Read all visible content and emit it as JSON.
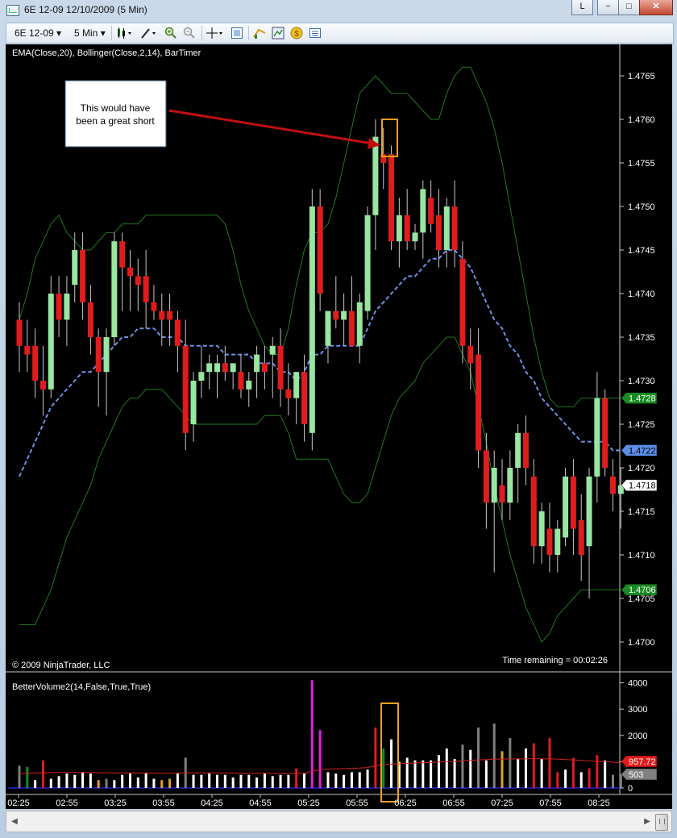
{
  "window": {
    "title": "6E 12-09  12/10/2009 (5 Min)",
    "buttons": {
      "layout": "L",
      "minimize": "−",
      "maximize": "□",
      "close": "✕"
    }
  },
  "toolbar": {
    "instrument": "6E 12-09",
    "interval": "5 Min",
    "icons": [
      "candlestick-style-icon",
      "drawing-tools-icon",
      "zoom-in-icon",
      "zoom-out-icon",
      "crosshair-icon",
      "data-box-icon",
      "bar-chart-icon",
      "chart-properties-icon",
      "order-entry-icon",
      "indicators-icon"
    ]
  },
  "price_panel": {
    "indicator_label": "EMA(Close,20), Bollinger(Close,2,14), BarTimer",
    "copyright": "© 2009 NinjaTrader, LLC",
    "timer_text": "Time remaining = 00:02:26",
    "annotation_text_1": "This would have",
    "annotation_text_2": "been a great short",
    "y_ticks": [
      "1.4765",
      "1.4760",
      "1.4755",
      "1.4750",
      "1.4745",
      "1.4740",
      "1.4735",
      "1.4730",
      "1.4725",
      "1.4720",
      "1.4715",
      "1.4710",
      "1.4705",
      "1.4700"
    ],
    "markers": [
      {
        "label": "1.4728",
        "color": "#1a8a22",
        "text_color": "#ffffff"
      },
      {
        "label": "1.4722",
        "color": "#5b8ee6",
        "text_color": "#000000"
      },
      {
        "label": "1.4718",
        "color": "#ffffff",
        "text_color": "#000000"
      },
      {
        "label": "1.4706",
        "color": "#1a8a22",
        "text_color": "#ffffff"
      }
    ]
  },
  "volume_panel": {
    "indicator_label": "BetterVolume2(14,False,True,True)",
    "y_ticks": [
      "4000",
      "3000",
      "2000",
      "1000",
      "0"
    ],
    "markers": [
      {
        "label": "957.72",
        "color": "#e31b1b",
        "text_color": "#ffffff"
      },
      {
        "label": "503",
        "color": "#808080",
        "text_color": "#ffffff"
      }
    ]
  },
  "x_ticks": [
    "02:25",
    "02:55",
    "03:25",
    "03:55",
    "04:25",
    "04:55",
    "05:25",
    "05:55",
    "06:25",
    "06:55",
    "07:25",
    "07:55",
    "08:25"
  ],
  "colors": {
    "up_candle": "#98e6a0",
    "down_candle": "#e01c1c",
    "wick": "#c8c8c8",
    "ema": "#6f8fe8",
    "bollinger": "#1f7a1f",
    "arrow": "#c01010",
    "highlight_box": "#f0a020",
    "volume_avg": "#d42020"
  },
  "chart_data": [
    {
      "type": "candlestick",
      "title": "6E 12-09 12/10/2009 (5 Min)",
      "ylim": [
        1.4698,
        1.4768
      ],
      "x_tick_labels": [
        "02:25",
        "02:55",
        "03:25",
        "03:55",
        "04:25",
        "04:55",
        "05:25",
        "05:55",
        "06:25",
        "06:55",
        "07:25",
        "07:55",
        "08:25"
      ],
      "candles": [
        {
          "o": 1.4737,
          "h": 1.4739,
          "l": 1.4731,
          "c": 1.4734
        },
        {
          "o": 1.4734,
          "h": 1.4737,
          "l": 1.4731,
          "c": 1.4733
        },
        {
          "o": 1.4734,
          "h": 1.4736,
          "l": 1.4728,
          "c": 1.473
        },
        {
          "o": 1.473,
          "h": 1.4734,
          "l": 1.4726,
          "c": 1.4729
        },
        {
          "o": 1.4729,
          "h": 1.4742,
          "l": 1.4728,
          "c": 1.474
        },
        {
          "o": 1.474,
          "h": 1.4742,
          "l": 1.4735,
          "c": 1.4737
        },
        {
          "o": 1.4737,
          "h": 1.4742,
          "l": 1.4734,
          "c": 1.474
        },
        {
          "o": 1.4741,
          "h": 1.4747,
          "l": 1.4739,
          "c": 1.4745
        },
        {
          "o": 1.4745,
          "h": 1.4747,
          "l": 1.4737,
          "c": 1.4739
        },
        {
          "o": 1.4739,
          "h": 1.4741,
          "l": 1.4733,
          "c": 1.4735
        },
        {
          "o": 1.4735,
          "h": 1.4736,
          "l": 1.4727,
          "c": 1.4731
        },
        {
          "o": 1.4731,
          "h": 1.4736,
          "l": 1.4726,
          "c": 1.4735
        },
        {
          "o": 1.4735,
          "h": 1.4747,
          "l": 1.4734,
          "c": 1.4746
        },
        {
          "o": 1.4746,
          "h": 1.4747,
          "l": 1.4738,
          "c": 1.4743
        },
        {
          "o": 1.4743,
          "h": 1.4745,
          "l": 1.4738,
          "c": 1.4742
        },
        {
          "o": 1.4742,
          "h": 1.4744,
          "l": 1.4738,
          "c": 1.4741
        },
        {
          "o": 1.4742,
          "h": 1.4745,
          "l": 1.4736,
          "c": 1.4739
        },
        {
          "o": 1.4739,
          "h": 1.4741,
          "l": 1.4737,
          "c": 1.4738
        },
        {
          "o": 1.4738,
          "h": 1.474,
          "l": 1.4734,
          "c": 1.4737
        },
        {
          "o": 1.4738,
          "h": 1.474,
          "l": 1.4734,
          "c": 1.4737
        },
        {
          "o": 1.4737,
          "h": 1.4738,
          "l": 1.4731,
          "c": 1.4734
        },
        {
          "o": 1.4734,
          "h": 1.4737,
          "l": 1.4722,
          "c": 1.4724
        },
        {
          "o": 1.4725,
          "h": 1.4731,
          "l": 1.4723,
          "c": 1.473
        },
        {
          "o": 1.473,
          "h": 1.4734,
          "l": 1.4728,
          "c": 1.4731
        },
        {
          "o": 1.4731,
          "h": 1.4733,
          "l": 1.4729,
          "c": 1.4732
        },
        {
          "o": 1.4731,
          "h": 1.4733,
          "l": 1.4728,
          "c": 1.4732
        },
        {
          "o": 1.4732,
          "h": 1.4734,
          "l": 1.473,
          "c": 1.4731
        },
        {
          "o": 1.4731,
          "h": 1.4732,
          "l": 1.4729,
          "c": 1.4732
        },
        {
          "o": 1.4731,
          "h": 1.4733,
          "l": 1.4728,
          "c": 1.4729
        },
        {
          "o": 1.4729,
          "h": 1.4731,
          "l": 1.4727,
          "c": 1.473
        },
        {
          "o": 1.4731,
          "h": 1.4734,
          "l": 1.4728,
          "c": 1.4733
        },
        {
          "o": 1.4732,
          "h": 1.4734,
          "l": 1.4729,
          "c": 1.4731
        },
        {
          "o": 1.4733,
          "h": 1.4735,
          "l": 1.4728,
          "c": 1.4734
        },
        {
          "o": 1.4734,
          "h": 1.4736,
          "l": 1.4727,
          "c": 1.4729
        },
        {
          "o": 1.4729,
          "h": 1.4732,
          "l": 1.4726,
          "c": 1.4728
        },
        {
          "o": 1.4728,
          "h": 1.4731,
          "l": 1.4725,
          "c": 1.4731
        },
        {
          "o": 1.4731,
          "h": 1.4733,
          "l": 1.4723,
          "c": 1.4725
        },
        {
          "o": 1.4724,
          "h": 1.4752,
          "l": 1.4722,
          "c": 1.475
        },
        {
          "o": 1.475,
          "h": 1.4752,
          "l": 1.4738,
          "c": 1.474
        },
        {
          "o": 1.4734,
          "h": 1.4738,
          "l": 1.4732,
          "c": 1.4738
        },
        {
          "o": 1.4738,
          "h": 1.4742,
          "l": 1.4736,
          "c": 1.4737
        },
        {
          "o": 1.4737,
          "h": 1.474,
          "l": 1.4734,
          "c": 1.4738
        },
        {
          "o": 1.4738,
          "h": 1.4742,
          "l": 1.4735,
          "c": 1.4734
        },
        {
          "o": 1.4734,
          "h": 1.474,
          "l": 1.4732,
          "c": 1.4739
        },
        {
          "o": 1.4738,
          "h": 1.475,
          "l": 1.4737,
          "c": 1.4749
        },
        {
          "o": 1.4749,
          "h": 1.476,
          "l": 1.4745,
          "c": 1.4758
        },
        {
          "o": 1.4756,
          "h": 1.4759,
          "l": 1.4752,
          "c": 1.4755
        },
        {
          "o": 1.4756,
          "h": 1.4757,
          "l": 1.4745,
          "c": 1.4746
        },
        {
          "o": 1.4746,
          "h": 1.4751,
          "l": 1.4743,
          "c": 1.4749
        },
        {
          "o": 1.4749,
          "h": 1.4752,
          "l": 1.4745,
          "c": 1.4746
        },
        {
          "o": 1.4746,
          "h": 1.4748,
          "l": 1.4745,
          "c": 1.4747
        },
        {
          "o": 1.4747,
          "h": 1.4753,
          "l": 1.4744,
          "c": 1.4752
        },
        {
          "o": 1.4751,
          "h": 1.4753,
          "l": 1.4747,
          "c": 1.4748
        },
        {
          "o": 1.4749,
          "h": 1.4752,
          "l": 1.4743,
          "c": 1.4745
        },
        {
          "o": 1.4745,
          "h": 1.4751,
          "l": 1.4743,
          "c": 1.475
        },
        {
          "o": 1.475,
          "h": 1.4753,
          "l": 1.4743,
          "c": 1.4745
        },
        {
          "o": 1.4744,
          "h": 1.4746,
          "l": 1.4732,
          "c": 1.4734
        },
        {
          "o": 1.4734,
          "h": 1.4736,
          "l": 1.4729,
          "c": 1.4732
        },
        {
          "o": 1.4733,
          "h": 1.4736,
          "l": 1.472,
          "c": 1.4722
        },
        {
          "o": 1.4722,
          "h": 1.4724,
          "l": 1.4713,
          "c": 1.4716
        },
        {
          "o": 1.4716,
          "h": 1.4722,
          "l": 1.4708,
          "c": 1.472
        },
        {
          "o": 1.4718,
          "h": 1.4721,
          "l": 1.4714,
          "c": 1.4716
        },
        {
          "o": 1.4716,
          "h": 1.4722,
          "l": 1.4714,
          "c": 1.472
        },
        {
          "o": 1.472,
          "h": 1.4725,
          "l": 1.4716,
          "c": 1.4724
        },
        {
          "o": 1.4724,
          "h": 1.4726,
          "l": 1.4718,
          "c": 1.472
        },
        {
          "o": 1.4719,
          "h": 1.4721,
          "l": 1.4709,
          "c": 1.4711
        },
        {
          "o": 1.4711,
          "h": 1.4716,
          "l": 1.4709,
          "c": 1.4715
        },
        {
          "o": 1.4713,
          "h": 1.4716,
          "l": 1.4708,
          "c": 1.471
        },
        {
          "o": 1.471,
          "h": 1.4714,
          "l": 1.4708,
          "c": 1.4713
        },
        {
          "o": 1.4712,
          "h": 1.472,
          "l": 1.4711,
          "c": 1.4719
        },
        {
          "o": 1.4719,
          "h": 1.4721,
          "l": 1.471,
          "c": 1.4713
        },
        {
          "o": 1.4714,
          "h": 1.4717,
          "l": 1.4707,
          "c": 1.471
        },
        {
          "o": 1.4711,
          "h": 1.472,
          "l": 1.4705,
          "c": 1.4719
        },
        {
          "o": 1.4719,
          "h": 1.4731,
          "l": 1.4716,
          "c": 1.4728
        },
        {
          "o": 1.4728,
          "h": 1.4729,
          "l": 1.4719,
          "c": 1.472
        },
        {
          "o": 1.4719,
          "h": 1.4721,
          "l": 1.4715,
          "c": 1.4717
        },
        {
          "o": 1.4717,
          "h": 1.472,
          "l": 1.4713,
          "c": 1.4718
        }
      ],
      "ema": [
        1.4719,
        1.4721,
        1.4723,
        1.4725,
        1.4727,
        1.4728,
        1.4729,
        1.473,
        1.4731,
        1.4731,
        1.4732,
        1.4733,
        1.4734,
        1.4735,
        1.4735,
        1.4736,
        1.4736,
        1.4736,
        1.4735,
        1.4735,
        1.4735,
        1.4734,
        1.4734,
        1.4734,
        1.4734,
        1.4734,
        1.4733,
        1.4733,
        1.4733,
        1.4733,
        1.4732,
        1.4732,
        1.4732,
        1.4731,
        1.4731,
        1.473,
        1.4731,
        1.4733,
        1.4733,
        1.4734,
        1.4734,
        1.4734,
        1.4734,
        1.4734,
        1.4736,
        1.4738,
        1.4739,
        1.474,
        1.4741,
        1.4742,
        1.4742,
        1.4743,
        1.4744,
        1.4744,
        1.4745,
        1.4745,
        1.4744,
        1.4743,
        1.4741,
        1.4739,
        1.4737,
        1.4736,
        1.4734,
        1.4733,
        1.4731,
        1.473,
        1.4728,
        1.4727,
        1.4726,
        1.4725,
        1.4724,
        1.4723,
        1.4723,
        1.4723,
        1.4723,
        1.4722,
        1.4722
      ],
      "bollinger_upper": [
        1.4737,
        1.474,
        1.4744,
        1.4746,
        1.4748,
        1.4749,
        1.4747,
        1.4746,
        1.4745,
        1.4745,
        1.4746,
        1.4747,
        1.4747,
        1.4748,
        1.4748,
        1.4748,
        1.4749,
        1.4749,
        1.4749,
        1.4749,
        1.4749,
        1.4749,
        1.4749,
        1.4749,
        1.4749,
        1.4749,
        1.4748,
        1.4745,
        1.4741,
        1.4738,
        1.4736,
        1.4734,
        1.4733,
        1.4733,
        1.4736,
        1.4741,
        1.4745,
        1.4747,
        1.4747,
        1.4748,
        1.4751,
        1.4755,
        1.4759,
        1.4763,
        1.4764,
        1.4765,
        1.4764,
        1.4763,
        1.4763,
        1.4763,
        1.4762,
        1.4761,
        1.476,
        1.476,
        1.4763,
        1.4765,
        1.4766,
        1.4766,
        1.4764,
        1.4762,
        1.4759,
        1.4755,
        1.475,
        1.4745,
        1.474,
        1.4735,
        1.4731,
        1.4728,
        1.4727,
        1.4727,
        1.4727,
        1.4728,
        1.4728,
        1.4728,
        1.4728,
        1.4728,
        1.4728
      ],
      "bollinger_lower": [
        1.4702,
        1.4702,
        1.4702,
        1.4704,
        1.4706,
        1.4709,
        1.4712,
        1.4714,
        1.4716,
        1.4718,
        1.4721,
        1.4723,
        1.4725,
        1.4727,
        1.4728,
        1.4728,
        1.4729,
        1.4729,
        1.4729,
        1.4728,
        1.4727,
        1.4726,
        1.4725,
        1.4725,
        1.4725,
        1.4725,
        1.4725,
        1.4725,
        1.4725,
        1.4725,
        1.4725,
        1.4726,
        1.4726,
        1.4726,
        1.4724,
        1.4721,
        1.4721,
        1.4721,
        1.4721,
        1.4721,
        1.4719,
        1.4717,
        1.4716,
        1.4716,
        1.4717,
        1.472,
        1.4723,
        1.4726,
        1.4728,
        1.4729,
        1.473,
        1.4732,
        1.4733,
        1.4734,
        1.4735,
        1.4735,
        1.4733,
        1.4731,
        1.4727,
        1.4723,
        1.4718,
        1.4714,
        1.471,
        1.4707,
        1.4704,
        1.4702,
        1.47,
        1.4701,
        1.4703,
        1.4704,
        1.4705,
        1.4706,
        1.4706,
        1.4706,
        1.4706,
        1.4706,
        1.4706
      ]
    },
    {
      "type": "bar",
      "title": "BetterVolume2(14,False,True,True)",
      "ylim": [
        0,
        4300
      ],
      "values": [
        850,
        800,
        300,
        1050,
        350,
        450,
        550,
        500,
        600,
        550,
        300,
        350,
        300,
        500,
        550,
        400,
        550,
        350,
        300,
        350,
        550,
        1150,
        500,
        500,
        550,
        500,
        500,
        400,
        500,
        500,
        400,
        550,
        450,
        500,
        500,
        750,
        550,
        4100,
        2200,
        600,
        550,
        500,
        600,
        600,
        700,
        2300,
        1500,
        1850,
        1000,
        1150,
        1050,
        1050,
        1050,
        1250,
        1500,
        1100,
        1650,
        1450,
        2300,
        1050,
        2450,
        1400,
        1900,
        1100,
        1500,
        1700,
        1100,
        1900,
        600,
        700,
        1150,
        600,
        750,
        1250,
        1050,
        500,
        550
      ],
      "colors": [
        "#808080",
        "#1a8a22",
        "#ffffff",
        "#e31b1b",
        "#ffffff",
        "#ffffff",
        "#ffffff",
        "#ffffff",
        "#ffffff",
        "#ffffff",
        "#e0a030",
        "#808080",
        "#ffffff",
        "#ffffff",
        "#ffffff",
        "#ffffff",
        "#ffffff",
        "#ffffff",
        "#e0a030",
        "#e0a030",
        "#ffffff",
        "#808080",
        "#ffffff",
        "#ffffff",
        "#ffffff",
        "#ffffff",
        "#ffffff",
        "#ffffff",
        "#ffffff",
        "#ffffff",
        "#ffffff",
        "#ffffff",
        "#ffffff",
        "#ffffff",
        "#ffffff",
        "#e31b1b",
        "#ffffff",
        "#e020e0",
        "#e020e0",
        "#ffffff",
        "#ffffff",
        "#ffffff",
        "#ffffff",
        "#ffffff",
        "#ffffff",
        "#e31b1b",
        "#1a8a22",
        "#ffffff",
        "#ffffff",
        "#ffffff",
        "#ffffff",
        "#ffffff",
        "#ffffff",
        "#ffffff",
        "#ffffff",
        "#ffffff",
        "#808080",
        "#ffffff",
        "#808080",
        "#ffffff",
        "#808080",
        "#e0a030",
        "#808080",
        "#ffffff",
        "#ffffff",
        "#e31b1b",
        "#ffffff",
        "#e31b1b",
        "#e31b1b",
        "#ffffff",
        "#e31b1b",
        "#ffffff",
        "#e31b1b",
        "#e31b1b",
        "#ffffff",
        "#808080",
        "#808080"
      ],
      "average": [
        550,
        560,
        570,
        580,
        585,
        590,
        590,
        590,
        590,
        585,
        580,
        580,
        575,
        575,
        575,
        570,
        570,
        565,
        560,
        560,
        560,
        580,
        580,
        580,
        575,
        575,
        570,
        570,
        565,
        565,
        560,
        560,
        555,
        555,
        555,
        560,
        560,
        640,
        700,
        720,
        730,
        740,
        750,
        760,
        780,
        850,
        880,
        910,
        920,
        940,
        950,
        960,
        970,
        990,
        1000,
        1010,
        1030,
        1050,
        1070,
        1080,
        1100,
        1100,
        1110,
        1110,
        1110,
        1120,
        1110,
        1110,
        1100,
        1080,
        1070,
        1050,
        1030,
        1010,
        1000,
        980,
        960
      ]
    }
  ]
}
